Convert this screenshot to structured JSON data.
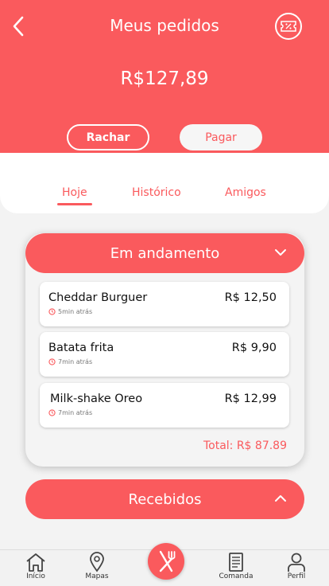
{
  "header": {
    "title": "Meus pedidos",
    "total": "R$127,89",
    "rachar_label": "Rachar",
    "pagar_label": "Pagar",
    "back_icon": "chevron-left-icon",
    "voucher_icon": "discount-ticket-icon"
  },
  "tabs": [
    {
      "label": "Hoje",
      "active": true
    },
    {
      "label": "Histórico",
      "active": false
    },
    {
      "label": "Amigos",
      "active": false
    }
  ],
  "sections": {
    "in_progress": {
      "title": "Em andamento",
      "expanded": true,
      "items": [
        {
          "name": "Cheddar Burguer",
          "price": "R$ 12,50",
          "time": "5min atrás"
        },
        {
          "name": "Batata frita",
          "price": "R$ 9,90",
          "time": "7min atrás"
        },
        {
          "name": "Milk-shake Oreo",
          "price": "R$ 12,99",
          "time": "7min atrás"
        }
      ],
      "total": "Total: R$ 87.89"
    },
    "received": {
      "title": "Recebidos",
      "expanded": false
    }
  },
  "bottom_nav": {
    "items": [
      {
        "label": "Início",
        "icon": "home-icon"
      },
      {
        "label": "Mapas",
        "icon": "map-pin-icon"
      },
      {
        "label": "Comanda",
        "icon": "receipt-icon"
      },
      {
        "label": "Perfil",
        "icon": "user-icon"
      }
    ],
    "center_icon": "fork-knife-icon"
  },
  "colors": {
    "accent": "#fa5a5d",
    "background": "#f3f3f3",
    "card": "#ffffff"
  }
}
